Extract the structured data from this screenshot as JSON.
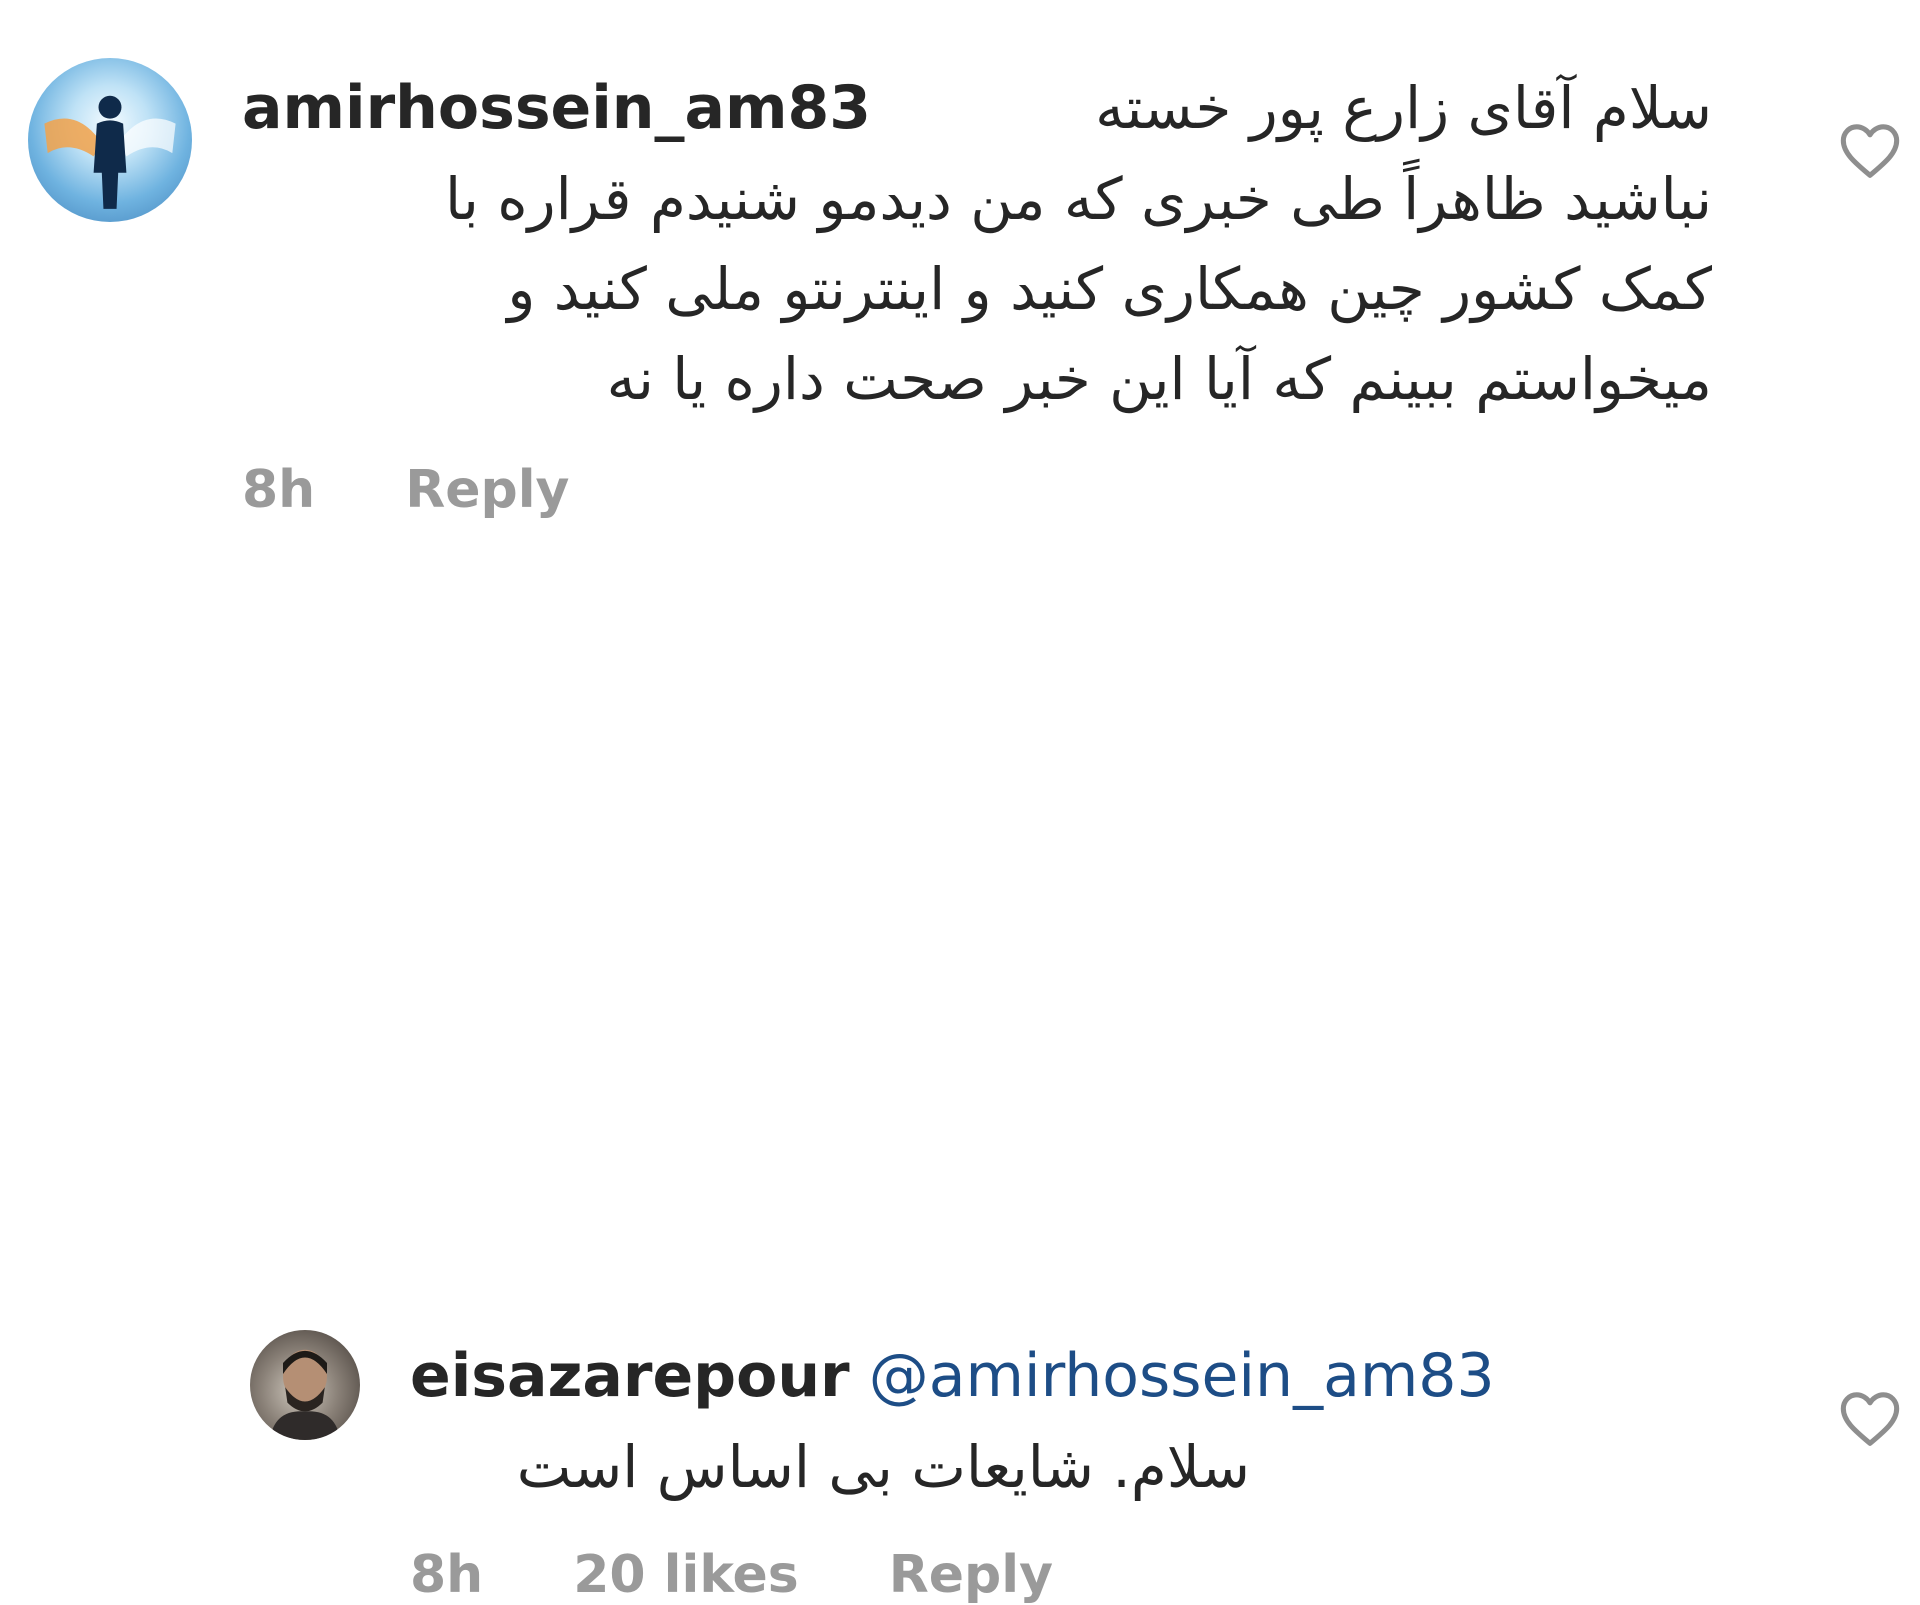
{
  "comments": [
    {
      "username": "amirhossein_am83",
      "text_lines": [
        "سلام آقای زارع پور خسته",
        "نباشید ظاهراً طی خبری که من دیدمو شنیدم قراره با",
        "کمک کشور چین همکاری کنید و اینترنتو ملی کنید و",
        "میخواستم ببینم که آیا این خبر صحت داره یا نه"
      ],
      "time": "8h",
      "reply_label": "Reply",
      "like_icon": "heart-outline-icon"
    },
    {
      "username": "eisazarepour",
      "mention": "@amirhossein_am83",
      "text": "سلام. شایعات بی اساس است",
      "time": "8h",
      "likes": "20 likes",
      "reply_label": "Reply",
      "like_icon": "heart-outline-icon"
    }
  ]
}
